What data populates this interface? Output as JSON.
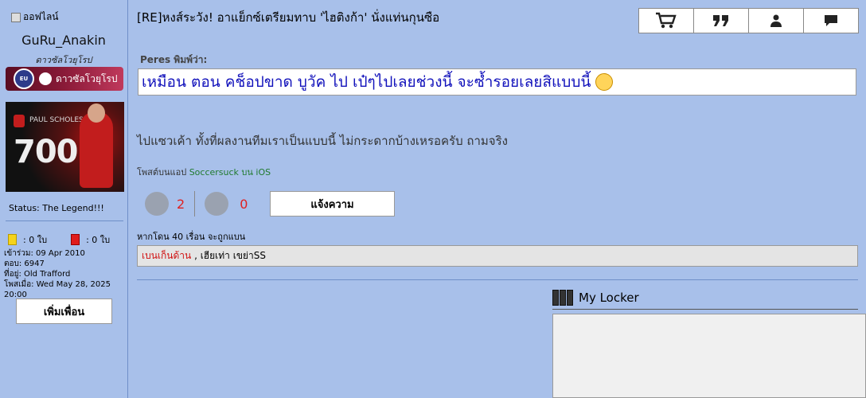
{
  "sidebar": {
    "online_status": "ออฟไลน์",
    "username": "GuRu_Anakin",
    "rank": "ดาวซัลโวยุโรป",
    "badge": {
      "eu": "EU",
      "label": "ดาวซัลโวยุโรป"
    },
    "avatar": {
      "name": "PAUL SCHOLES",
      "number": "700"
    },
    "status_text": "Status: The Legend!!!",
    "yellow_cards": ": 0 ใบ",
    "red_cards": ": 0 ใบ",
    "info": {
      "joined": "เข้าร่วม: 09 Apr 2010",
      "posts": "ตอบ: 6947",
      "location": "ที่อยู่: Old Trafford",
      "posted": "โพสเมื่อ: Wed May 28, 2025 20:00"
    },
    "add_friend": "เพิ่มเพื่อน"
  },
  "post": {
    "title": "[RE]หงส์ระวัง! อาแย็กซ์เตรียมทาบ 'ไฮติงก้า' นั่งแท่นกุนซือ",
    "toolbar": [
      "cart-icon",
      "quote-icon",
      "user-icon",
      "message-icon"
    ],
    "quote_by": "Peres พิมพ์ว่า:",
    "quote_text": "เหมือน ตอน คช็อปขาด บูวัค ไป เป๋ๆไปเลยช่วงนี้ จะซ้ำรอยเลยสิแบบนี้",
    "body": "ไปแซวเค้า ทั้งที่ผลงานทีมเราเป็นแบบนี้ ไม่กระดากบ้างเหรอครับ ถามจริง",
    "via_prefix": "โพสต์บนแอป",
    "via_app": "Soccersuck บน iOS",
    "likes": "2",
    "dislikes": "0",
    "report": "แจ้งความ",
    "ban_note": "หากโดน 40 เรื่อน จะถูกแบน",
    "ban_red": "เบนเก็นด้าน",
    "ban_rest": ", เฮียเท่า เขย่าSS"
  },
  "locker": {
    "title": "My Locker"
  }
}
